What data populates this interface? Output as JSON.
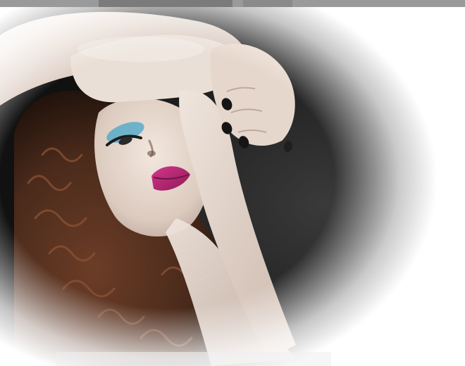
{
  "top_strip": {
    "left_text": "",
    "right_text": ""
  },
  "bottom_strip": {
    "text": ""
  },
  "colors": {
    "background": "#ffffff",
    "skin": "#e7d9cf",
    "skin_shadow": "#b9a398",
    "hair": "#5a3422",
    "hair_dark": "#2a1610",
    "lips": "#b3246f",
    "eyeshadow": "#4fa9c8",
    "nails": "#1a1a1a",
    "shadow": "#2b2b2b"
  },
  "icons": {
    "photo": "portrait-photo-icon"
  }
}
